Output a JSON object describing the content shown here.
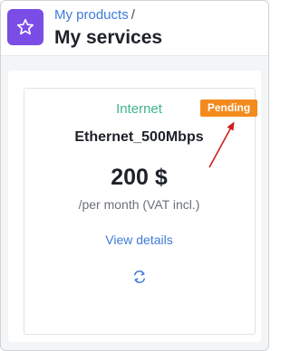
{
  "header": {
    "breadcrumb_parent": "My products",
    "breadcrumb_separator": "/",
    "title": "My services",
    "logo_icon": "star-icon",
    "logo_color": "#7b4ce6"
  },
  "service_card": {
    "category": "Internet",
    "status": "Pending",
    "name": "Ethernet_500Mbps",
    "price": "200 $",
    "price_note": "/per month (VAT incl.)",
    "details_link": "View details",
    "renew_icon": "refresh-icon"
  },
  "colors": {
    "accent_blue": "#3d7bd9",
    "category_green": "#3fb58a",
    "status_orange": "#f38a1d",
    "annotation_red": "#cc1f1f"
  }
}
